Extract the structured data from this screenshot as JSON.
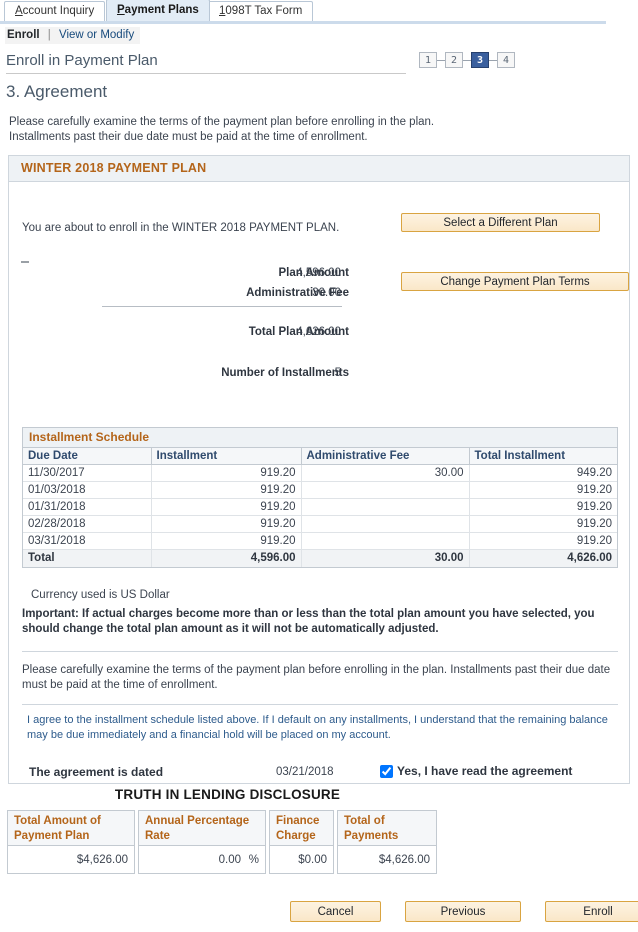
{
  "tabs": [
    {
      "label": "Account Inquiry",
      "accesskey": "A",
      "active": false
    },
    {
      "label": "Payment Plans",
      "accesskey": "P",
      "active": true
    },
    {
      "label": "1098T Tax Form",
      "accesskey": "1",
      "active": false
    }
  ],
  "subnav": {
    "current": "Enroll",
    "separator": "|",
    "link": "View or Modify"
  },
  "page": {
    "title": "Enroll in Payment Plan",
    "section_title": "3. Agreement",
    "intro_line1": "Please carefully examine the terms of the payment plan before enrolling in the plan.",
    "intro_line2": "Installments past their due date must be paid at the time of enrollment."
  },
  "steps": {
    "items": [
      "1",
      "2",
      "3",
      "4"
    ],
    "current": "3",
    "active_color": "#3a5f9e"
  },
  "panel": {
    "header": "WINTER 2018 PAYMENT PLAN",
    "header_color": "#b4651a",
    "enroll_line": "You are about to enroll in the WINTER 2018 PAYMENT PLAN.",
    "select_plan_button": "Select a Different Plan",
    "change_terms_button": "Change Payment Plan Terms",
    "summary": [
      {
        "label": "Plan Amount",
        "value": "4,596.00"
      },
      {
        "label": "Administrative Fee",
        "value": "30.00"
      },
      {
        "label": "Total Plan Amount",
        "value": "4,626.00"
      },
      {
        "label": "Number of Installments",
        "value": "5"
      }
    ]
  },
  "schedule": {
    "title": "Installment Schedule",
    "columns": [
      "Due Date",
      "Installment",
      "Administrative Fee",
      "Total Installment"
    ],
    "rows": [
      {
        "due_date": "11/30/2017",
        "installment": "919.20",
        "admin_fee": "30.00",
        "total": "949.20"
      },
      {
        "due_date": "01/03/2018",
        "installment": "919.20",
        "admin_fee": "",
        "total": "919.20"
      },
      {
        "due_date": "01/31/2018",
        "installment": "919.20",
        "admin_fee": "",
        "total": "919.20"
      },
      {
        "due_date": "02/28/2018",
        "installment": "919.20",
        "admin_fee": "",
        "total": "919.20"
      },
      {
        "due_date": "03/31/2018",
        "installment": "919.20",
        "admin_fee": "",
        "total": "919.20"
      }
    ],
    "total_row": {
      "label": "Total",
      "installment": "4,596.00",
      "admin_fee": "30.00",
      "total": "4,626.00"
    }
  },
  "notes": {
    "currency": "Currency used is US Dollar",
    "important": "Important: If actual charges become more than or less than the total plan amount you have selected, you should change the total plan amount as it will not be automatically adjusted.",
    "terms": "Please carefully examine the terms of the payment plan before enrolling in the plan. Installments past their due date must be paid at the time of enrollment.",
    "agreement": "I agree to the installment schedule listed above. If I default on any installments, I understand that the remaining balance may be due immediately and a financial hold will be placed on my account."
  },
  "agreement": {
    "dated_label": "The agreement is dated",
    "dated_value": "03/21/2018",
    "checkbox_label": "Yes, I have read the agreement",
    "checked": true
  },
  "til": {
    "title": "TRUTH IN LENDING DISCLOSURE",
    "columns": [
      {
        "header": "Total Amount of Payment Plan",
        "value": "$4,626.00"
      },
      {
        "header": "Annual Percentage Rate",
        "value": "0.00",
        "suffix": "%"
      },
      {
        "header": "Finance Charge",
        "value": "$0.00"
      },
      {
        "header": "Total of Payments",
        "value": "$4,626.00"
      }
    ]
  },
  "footer": {
    "cancel": "Cancel",
    "previous": "Previous",
    "enroll": "Enroll"
  }
}
